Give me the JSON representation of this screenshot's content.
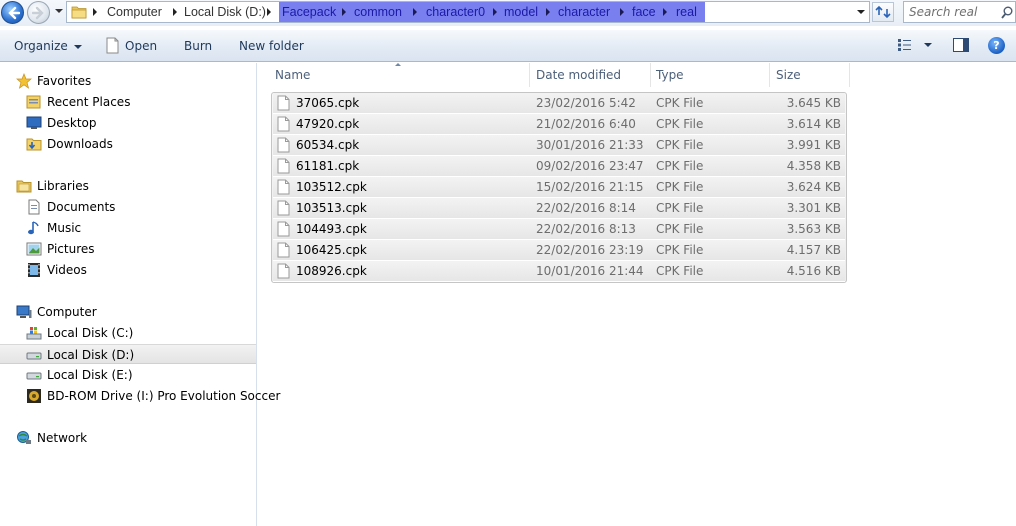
{
  "address_bar": {
    "breadcrumbs": [
      "Computer",
      "Local Disk (D:)",
      "Facepack",
      "common",
      "character0",
      "model",
      "character",
      "face",
      "real"
    ],
    "search_placeholder": "Search real"
  },
  "toolbar": {
    "organize_label": "Organize",
    "open_label": "Open",
    "burn_label": "Burn",
    "new_folder_label": "New folder"
  },
  "sidebar": {
    "favorites": {
      "label": "Favorites",
      "items": [
        "Recent Places",
        "Desktop",
        "Downloads"
      ]
    },
    "libraries": {
      "label": "Libraries",
      "items": [
        "Documents",
        "Music",
        "Pictures",
        "Videos"
      ]
    },
    "computer": {
      "label": "Computer",
      "items": [
        "Local Disk (C:)",
        "Local Disk (D:)",
        "Local Disk (E:)",
        "BD-ROM Drive (I:) Pro Evolution Soccer"
      ]
    },
    "network": {
      "label": "Network"
    },
    "selected": "Local Disk (D:)"
  },
  "columns": {
    "name": "Name",
    "date": "Date modified",
    "type": "Type",
    "size": "Size"
  },
  "files": [
    {
      "name": "37065.cpk",
      "date": "23/02/2016 5:42",
      "type": "CPK File",
      "size": "3.645 KB"
    },
    {
      "name": "47920.cpk",
      "date": "21/02/2016 6:40",
      "type": "CPK File",
      "size": "3.614 KB"
    },
    {
      "name": "60534.cpk",
      "date": "30/01/2016 21:33",
      "type": "CPK File",
      "size": "3.991 KB"
    },
    {
      "name": "61181.cpk",
      "date": "09/02/2016 23:47",
      "type": "CPK File",
      "size": "4.358 KB"
    },
    {
      "name": "103512.cpk",
      "date": "15/02/2016 21:15",
      "type": "CPK File",
      "size": "3.624 KB"
    },
    {
      "name": "103513.cpk",
      "date": "22/02/2016 8:14",
      "type": "CPK File",
      "size": "3.301 KB"
    },
    {
      "name": "104493.cpk",
      "date": "22/02/2016 8:13",
      "type": "CPK File",
      "size": "3.563 KB"
    },
    {
      "name": "106425.cpk",
      "date": "22/02/2016 23:19",
      "type": "CPK File",
      "size": "4.157 KB"
    },
    {
      "name": "108926.cpk",
      "date": "10/01/2016 21:44",
      "type": "CPK File",
      "size": "4.516 KB"
    }
  ]
}
